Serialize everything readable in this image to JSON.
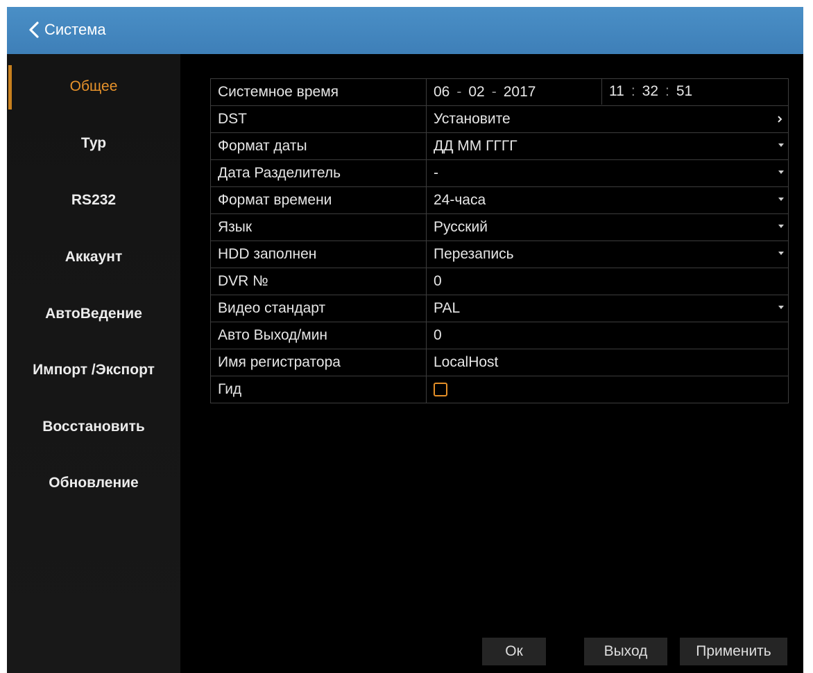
{
  "header": {
    "back_label": "Система"
  },
  "sidebar": {
    "items": [
      {
        "label": "Общее"
      },
      {
        "label": "Тур"
      },
      {
        "label": "RS232"
      },
      {
        "label": "Аккаунт"
      },
      {
        "label": "АвтоВедение"
      },
      {
        "label": "Импорт /Экспорт"
      },
      {
        "label": "Восстановить"
      },
      {
        "label": "Обновление"
      }
    ]
  },
  "settings": {
    "system_time": {
      "label": "Системное время",
      "day": "06",
      "month": "02",
      "year": "2017",
      "date_sep": "-",
      "hour": "11",
      "minute": "32",
      "second": "51",
      "time_sep": ":"
    },
    "dst": {
      "label": "DST",
      "value": "Установите"
    },
    "date_format": {
      "label": "Формат даты",
      "value": "ДД ММ ГГГГ"
    },
    "date_separator": {
      "label": "Дата Разделитель",
      "value": "-"
    },
    "time_format": {
      "label": "Формат времени",
      "value": "24-часа"
    },
    "language": {
      "label": "Язык",
      "value": "Русский"
    },
    "hdd_full": {
      "label": "HDD заполнен",
      "value": "Перезапись"
    },
    "dvr_no": {
      "label": "DVR №",
      "value": "0"
    },
    "video_standard": {
      "label": "Видео стандарт",
      "value": "PAL"
    },
    "auto_logout": {
      "label": "Авто Выход/мин",
      "value": "0"
    },
    "device_name": {
      "label": "Имя регистратора",
      "value": "LocalHost"
    },
    "guide": {
      "label": "Гид",
      "checked": false
    }
  },
  "footer": {
    "ok_label": "Ок",
    "exit_label": "Выход",
    "apply_label": "Применить"
  },
  "colors": {
    "accent": "#e8932b",
    "header": "#4a8fc6"
  }
}
